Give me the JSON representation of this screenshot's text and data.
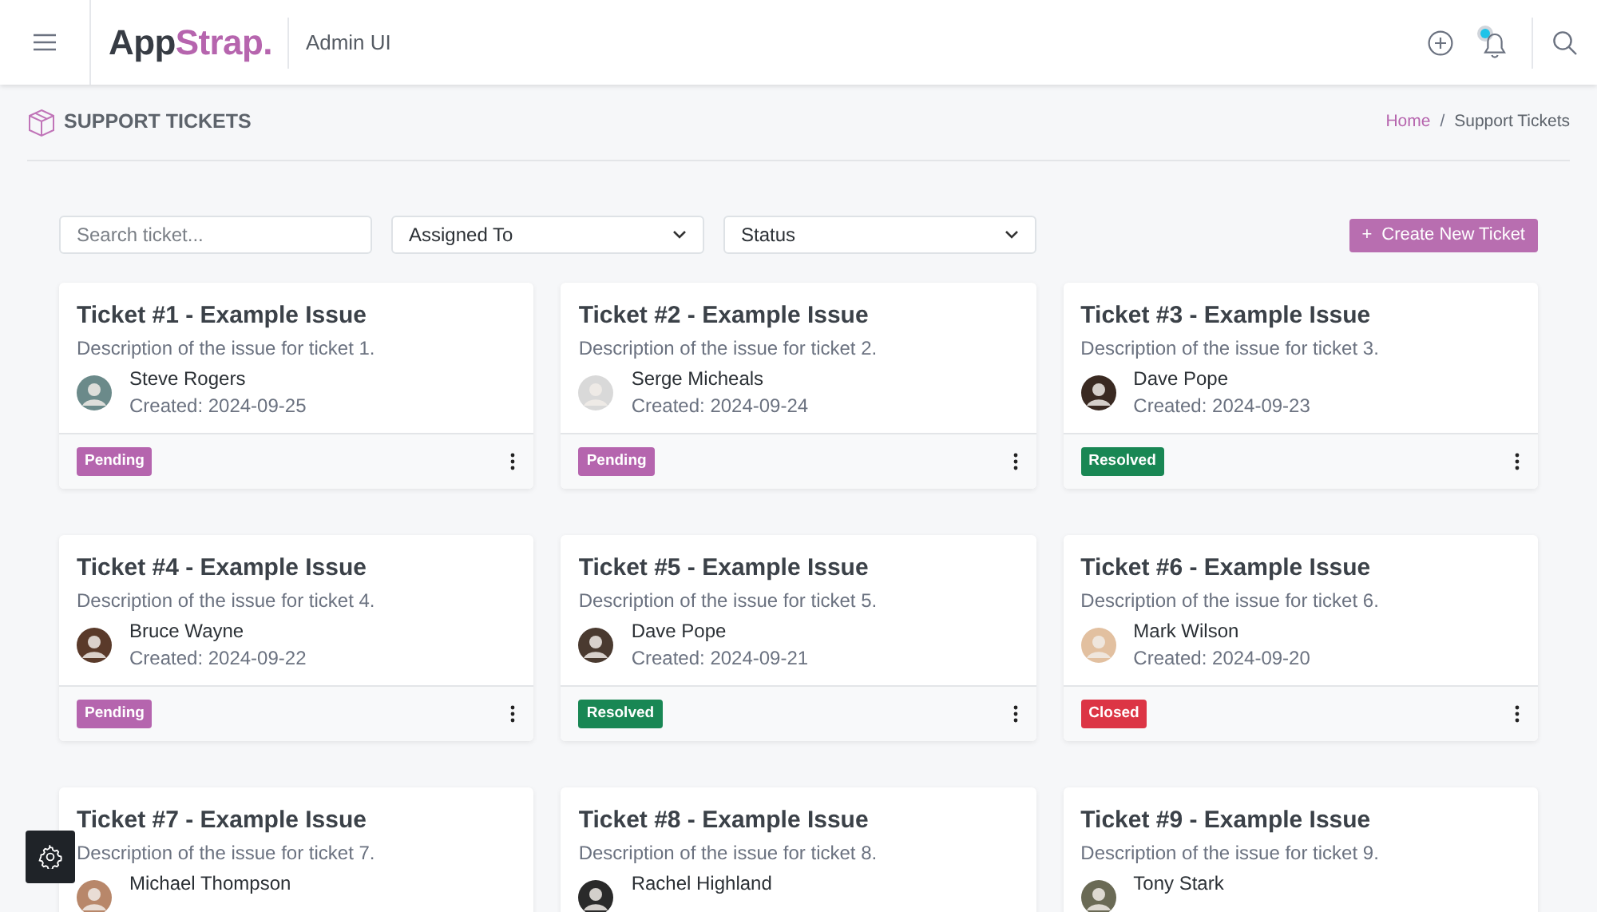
{
  "header": {
    "logo_main": "App",
    "logo_accent": "Strap.",
    "subtitle": "Admin UI",
    "notification_unread": true
  },
  "page": {
    "title": "SUPPORT TICKETS",
    "breadcrumb": [
      {
        "label": "Home",
        "link": true
      },
      {
        "label": "Support Tickets",
        "link": false
      }
    ],
    "separator": "/"
  },
  "filters": {
    "search": {
      "placeholder": "Search ticket..."
    },
    "selects": [
      "Assigned To",
      "Status"
    ],
    "create_button": {
      "icon": "+",
      "label": "Create New Ticket"
    }
  },
  "tickets": [
    {
      "title": "Ticket #1 - Example Issue",
      "description": "Description of the issue for ticket 1.",
      "assignee": "Steve Rogers",
      "created": "Created: 2024-09-25",
      "status": {
        "kind": "pending",
        "label": "Pending"
      }
    },
    {
      "title": "Ticket #2 - Example Issue",
      "description": "Description of the issue for ticket 2.",
      "assignee": "Serge Micheals",
      "created": "Created: 2024-09-24",
      "status": {
        "kind": "pending",
        "label": "Pending"
      }
    },
    {
      "title": "Ticket #3 - Example Issue",
      "description": "Description of the issue for ticket 3.",
      "assignee": "Dave Pope",
      "created": "Created: 2024-09-23",
      "status": {
        "kind": "resolved",
        "label": "Resolved"
      }
    },
    {
      "title": "Ticket #4 - Example Issue",
      "description": "Description of the issue for ticket 4.",
      "assignee": "Bruce Wayne",
      "created": "Created: 2024-09-22",
      "status": {
        "kind": "pending",
        "label": "Pending"
      }
    },
    {
      "title": "Ticket #5 - Example Issue",
      "description": "Description of the issue for ticket 5.",
      "assignee": "Dave Pope",
      "created": "Created: 2024-09-21",
      "status": {
        "kind": "resolved",
        "label": "Resolved"
      }
    },
    {
      "title": "Ticket #6 - Example Issue",
      "description": "Description of the issue for ticket 6.",
      "assignee": "Mark Wilson",
      "created": "Created: 2024-09-20",
      "status": {
        "kind": "closed",
        "label": "Closed"
      }
    },
    {
      "title": "Ticket #7 - Example Issue",
      "description": "Description of the issue for ticket 7.",
      "assignee": "Michael Thompson"
    },
    {
      "title": "Ticket #8 - Example Issue",
      "description": "Description of the issue for ticket 8.",
      "assignee": "Rachel Highland"
    },
    {
      "title": "Ticket #9 - Example Issue",
      "description": "Description of the issue for ticket 9.",
      "assignee": "Tony Stark"
    }
  ]
}
